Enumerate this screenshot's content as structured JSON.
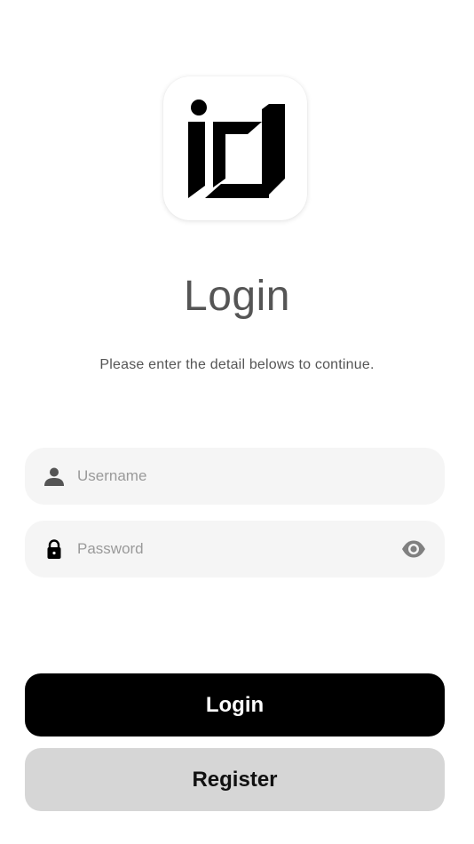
{
  "app": {
    "logo_icon": "brand-logo-icon"
  },
  "header": {
    "title": "Login",
    "subtitle": "Please enter the detail belows to continue."
  },
  "form": {
    "username": {
      "placeholder": "Username",
      "value": "",
      "icon": "person-icon"
    },
    "password": {
      "placeholder": "Password",
      "value": "",
      "icon": "lock-icon",
      "toggle_icon": "eye-icon"
    }
  },
  "actions": {
    "login_label": "Login",
    "register_label": "Register"
  },
  "colors": {
    "primary_button": "#000000",
    "secondary_button": "#d6d6d6",
    "field_background": "#f5f5f5",
    "title_text": "#555555"
  }
}
